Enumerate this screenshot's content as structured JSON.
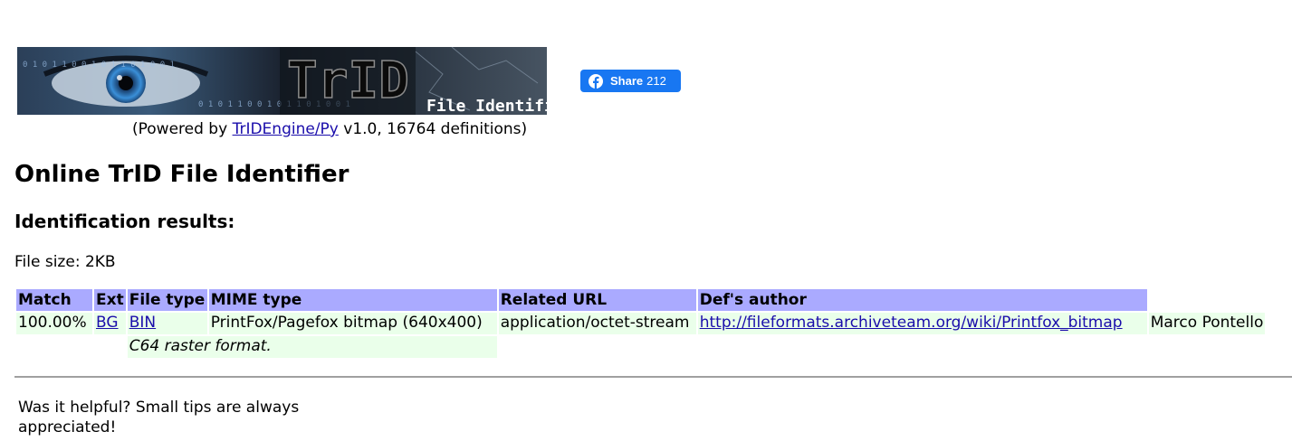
{
  "banner": {
    "logo_text": "TrID",
    "subtitle": "File Identifier",
    "binary_digits": "0 1 0 1 1 0 0 1 0 1 1 0 1 0 0 1"
  },
  "powered": {
    "prefix": "(Powered by ",
    "link_label": "TrIDEngine/Py",
    "suffix": " v1.0, 16764 definitions)"
  },
  "share": {
    "label": "Share",
    "count": "212",
    "color": "#1877f2"
  },
  "page_title": "Online TrID File Identifier",
  "results_heading": "Identification results:",
  "file_size": "File size: 2KB",
  "table": {
    "header_color": "#aaaaff",
    "row_color": "#eaffea",
    "headers": {
      "match": "Match",
      "ext": "Ext",
      "file_type": "File type",
      "mime": "MIME type",
      "url": "Related URL",
      "author": "Def's author"
    },
    "rows": [
      {
        "match": "100.00%",
        "ext": "BG",
        "bin": "BIN",
        "file_type": "PrintFox/Pagefox bitmap (640x400)",
        "mime": "application/octet-stream",
        "url": "http://fileformats.archiveteam.org/wiki/Printfox_bitmap",
        "author": "Marco Pontello",
        "description": "C64 raster format."
      }
    ]
  },
  "tips": "Was it helpful? Small tips are always appreciated!"
}
